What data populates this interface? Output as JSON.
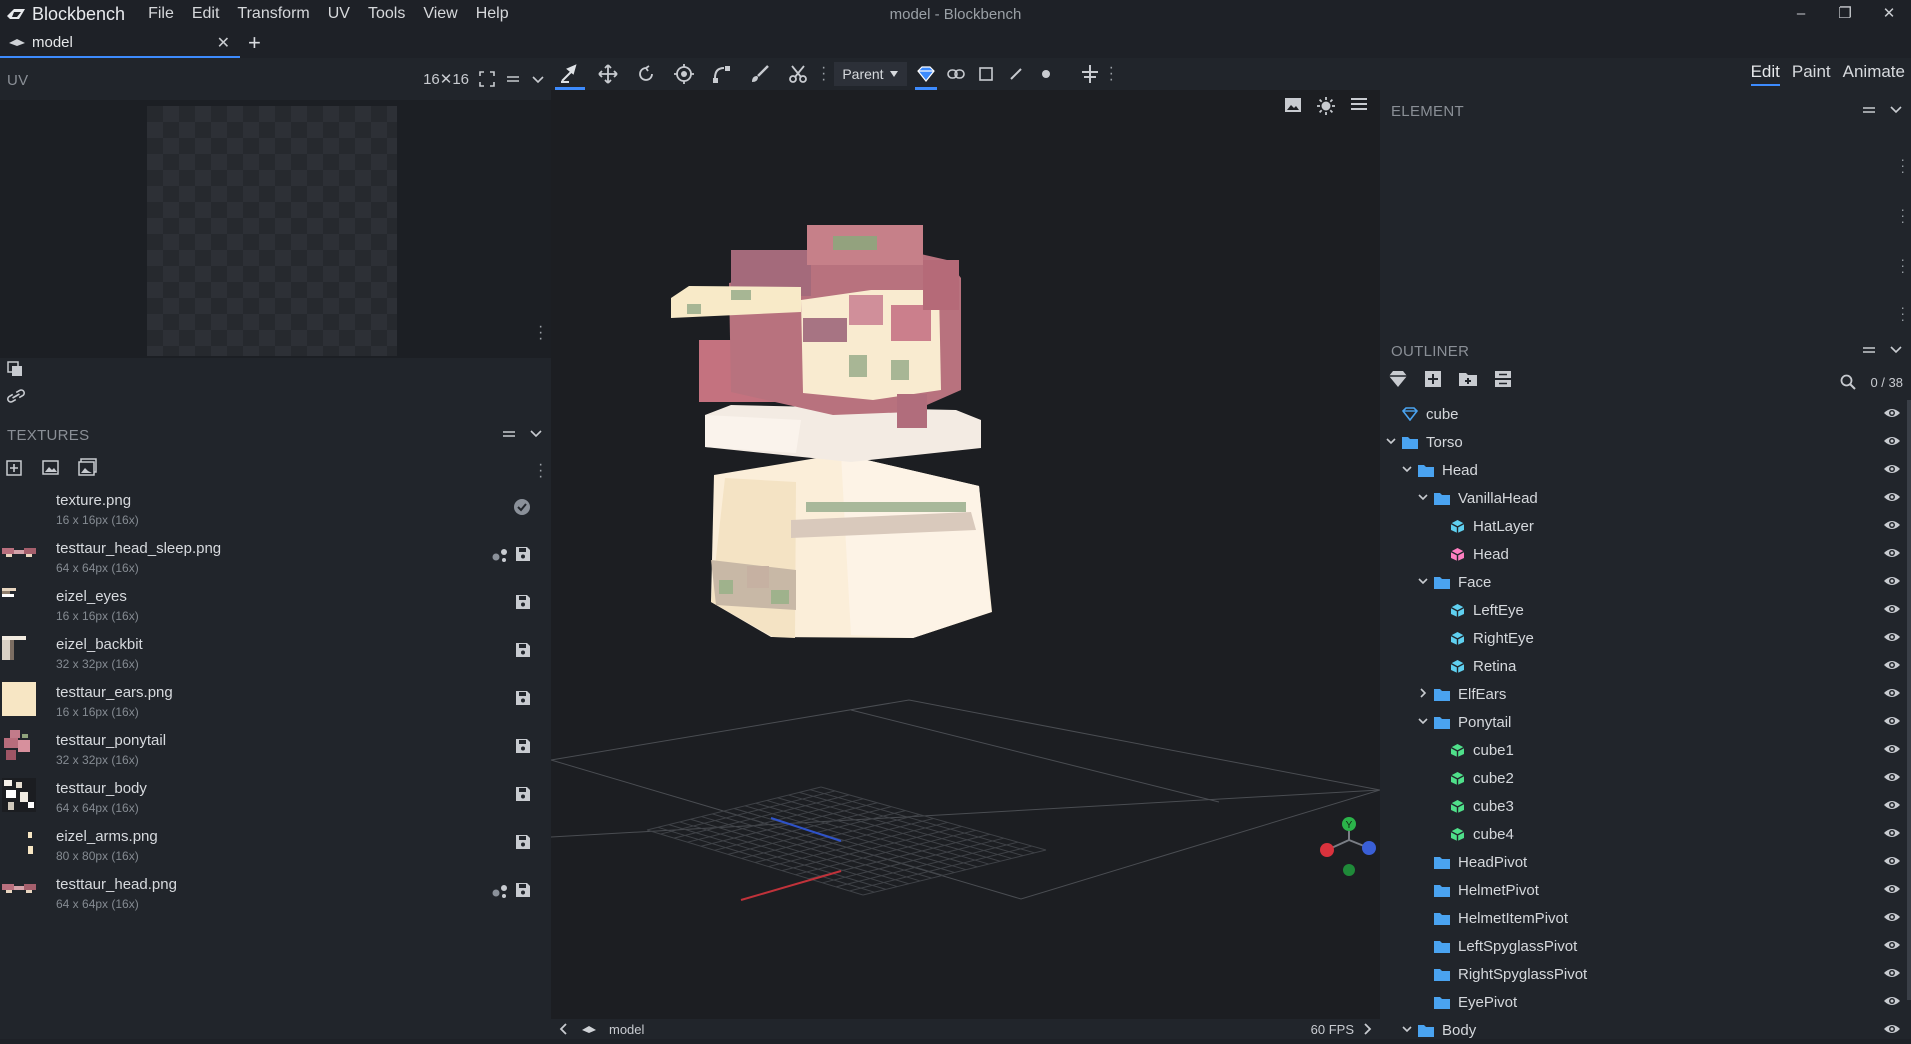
{
  "app": {
    "name": "Blockbench",
    "window_title": "model - Blockbench",
    "menu": [
      "File",
      "Edit",
      "Transform",
      "UV",
      "Tools",
      "View",
      "Help"
    ],
    "window_controls": [
      "–",
      "❐",
      "✕"
    ]
  },
  "tabs": [
    {
      "label": "model",
      "close": "✕"
    }
  ],
  "tab_add": "+",
  "uv_panel": {
    "title": "UV",
    "grid_size": "16✕16"
  },
  "textures_panel": {
    "title": "TEXTURES",
    "items": [
      {
        "name": "texture.png",
        "size": "16 x 16px (16x)",
        "thumb": "none",
        "actions": [
          "check"
        ]
      },
      {
        "name": "testtaur_head_sleep.png",
        "size": "64 x 64px (16x)",
        "thumb": "pink",
        "actions": [
          "share",
          "save"
        ]
      },
      {
        "name": "eizel_eyes",
        "size": "16 x 16px (16x)",
        "thumb": "eyes",
        "actions": [
          "save"
        ]
      },
      {
        "name": "eizel_backbit",
        "size": "32 x 32px (16x)",
        "thumb": "backbit",
        "actions": [
          "save"
        ]
      },
      {
        "name": "testtaur_ears.png",
        "size": "16 x 16px (16x)",
        "thumb": "cream",
        "actions": [
          "save"
        ]
      },
      {
        "name": "testtaur_ponytail",
        "size": "32 x 32px (16x)",
        "thumb": "ponytail",
        "actions": [
          "save"
        ]
      },
      {
        "name": "testtaur_body",
        "size": "64 x 64px (16x)",
        "thumb": "body",
        "actions": [
          "save"
        ]
      },
      {
        "name": "eizel_arms.png",
        "size": "80 x 80px (16x)",
        "thumb": "arms",
        "actions": [
          "save"
        ]
      },
      {
        "name": "testtaur_head.png",
        "size": "64 x 64px (16x)",
        "thumb": "pink",
        "actions": [
          "share",
          "save"
        ]
      }
    ]
  },
  "toolbar": {
    "pivot_mode": "Parent"
  },
  "statusbar": {
    "model_name": "model",
    "fps": "60 FPS"
  },
  "gizmo": {
    "y": "Y"
  },
  "modes": [
    {
      "label": "Edit",
      "active": true
    },
    {
      "label": "Paint",
      "active": false
    },
    {
      "label": "Animate",
      "active": false
    }
  ],
  "element_panel": {
    "title": "ELEMENT"
  },
  "outliner": {
    "title": "OUTLINER",
    "count": "0 / 38",
    "items": [
      {
        "label": "cube",
        "type": "mesh",
        "depth": 0,
        "chev": ""
      },
      {
        "label": "Torso",
        "type": "folder",
        "depth": 0,
        "chev": "open"
      },
      {
        "label": "Head",
        "type": "folder",
        "depth": 1,
        "chev": "open"
      },
      {
        "label": "VanillaHead",
        "type": "folder",
        "depth": 2,
        "chev": "open"
      },
      {
        "label": "HatLayer",
        "type": "cube-blue",
        "depth": 3,
        "chev": ""
      },
      {
        "label": "Head",
        "type": "cube-pink",
        "depth": 3,
        "chev": ""
      },
      {
        "label": "Face",
        "type": "folder",
        "depth": 2,
        "chev": "open"
      },
      {
        "label": "LeftEye",
        "type": "cube-blue",
        "depth": 3,
        "chev": ""
      },
      {
        "label": "RightEye",
        "type": "cube-blue",
        "depth": 3,
        "chev": ""
      },
      {
        "label": "Retina",
        "type": "cube-blue",
        "depth": 3,
        "chev": ""
      },
      {
        "label": "ElfEars",
        "type": "folder",
        "depth": 2,
        "chev": "closed"
      },
      {
        "label": "Ponytail",
        "type": "folder",
        "depth": 2,
        "chev": "open"
      },
      {
        "label": "cube1",
        "type": "cube-green",
        "depth": 3,
        "chev": ""
      },
      {
        "label": "cube2",
        "type": "cube-green",
        "depth": 3,
        "chev": ""
      },
      {
        "label": "cube3",
        "type": "cube-green",
        "depth": 3,
        "chev": ""
      },
      {
        "label": "cube4",
        "type": "cube-green",
        "depth": 3,
        "chev": ""
      },
      {
        "label": "HeadPivot",
        "type": "folder",
        "depth": 2,
        "chev": ""
      },
      {
        "label": "HelmetPivot",
        "type": "folder",
        "depth": 2,
        "chev": ""
      },
      {
        "label": "HelmetItemPivot",
        "type": "folder",
        "depth": 2,
        "chev": ""
      },
      {
        "label": "LeftSpyglassPivot",
        "type": "folder",
        "depth": 2,
        "chev": ""
      },
      {
        "label": "RightSpyglassPivot",
        "type": "folder",
        "depth": 2,
        "chev": ""
      },
      {
        "label": "EyePivot",
        "type": "folder",
        "depth": 2,
        "chev": ""
      },
      {
        "label": "Body",
        "type": "folder",
        "depth": 1,
        "chev": "open"
      }
    ]
  },
  "colors": {
    "accent": "#3d8bfd",
    "folder": "#4aa3f0",
    "cube_blue": "#5fd0f0",
    "cube_pink": "#ff7fc0",
    "cube_green": "#4fe08a"
  }
}
